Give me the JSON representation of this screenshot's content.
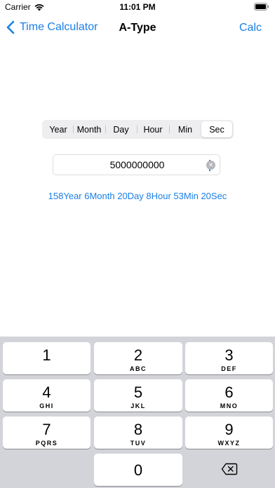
{
  "status_bar": {
    "carrier": "Carrier",
    "time": "11:01 PM"
  },
  "nav": {
    "back_label": "Time Calculator",
    "title": "A-Type",
    "action_label": "Calc"
  },
  "segments": [
    {
      "label": "Year",
      "selected": false
    },
    {
      "label": "Month",
      "selected": false
    },
    {
      "label": "Day",
      "selected": false
    },
    {
      "label": "Hour",
      "selected": false
    },
    {
      "label": "Min",
      "selected": false
    },
    {
      "label": "Sec",
      "selected": true
    }
  ],
  "input": {
    "value": "5000000000"
  },
  "result": {
    "text": "158Year 6Month 20Day 8Hour 53Min 20Sec"
  },
  "keyboard": {
    "keys": [
      {
        "digit": "1",
        "letters": ""
      },
      {
        "digit": "2",
        "letters": "ABC"
      },
      {
        "digit": "3",
        "letters": "DEF"
      },
      {
        "digit": "4",
        "letters": "GHI"
      },
      {
        "digit": "5",
        "letters": "JKL"
      },
      {
        "digit": "6",
        "letters": "MNO"
      },
      {
        "digit": "7",
        "letters": "PQRS"
      },
      {
        "digit": "8",
        "letters": "TUV"
      },
      {
        "digit": "9",
        "letters": "WXYZ"
      },
      {
        "digit": "0",
        "letters": ""
      }
    ]
  },
  "colors": {
    "accent": "#1a7fe6",
    "keyboard_bg": "#d2d4d9",
    "segment_bg": "#eeeef0"
  },
  "icons": {
    "back": "chevron-left-icon",
    "clear": "clear-circle-icon",
    "delete": "backspace-icon",
    "wifi": "wifi-icon",
    "battery": "battery-icon"
  }
}
